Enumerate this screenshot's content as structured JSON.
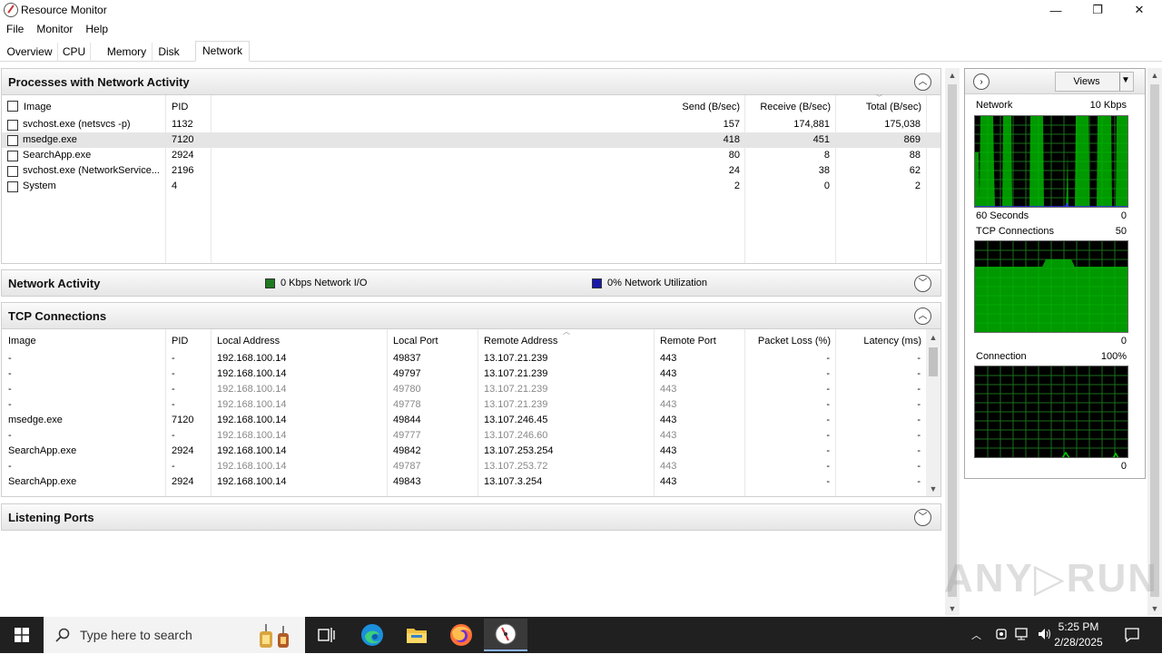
{
  "window": {
    "title": "Resource Monitor",
    "controls": {
      "minimize": "—",
      "maximize": "❐",
      "close": "✕"
    }
  },
  "menu": [
    "File",
    "Monitor",
    "Help"
  ],
  "tabs": [
    {
      "label": "Overview"
    },
    {
      "label": "CPU"
    },
    {
      "label": "Memory"
    },
    {
      "label": "Disk"
    },
    {
      "label": "Network",
      "active": true
    }
  ],
  "processes": {
    "title": "Processes with Network Activity",
    "columns": {
      "image": "Image",
      "pid": "PID",
      "send": "Send (B/sec)",
      "receive": "Receive (B/sec)",
      "total": "Total (B/sec)"
    },
    "rows": [
      {
        "image": "svchost.exe (netsvcs -p)",
        "pid": "1132",
        "send": "157",
        "receive": "174,881",
        "total": "175,038"
      },
      {
        "image": "msedge.exe",
        "pid": "7120",
        "send": "418",
        "receive": "451",
        "total": "869",
        "selected": true
      },
      {
        "image": "SearchApp.exe",
        "pid": "2924",
        "send": "80",
        "receive": "8",
        "total": "88"
      },
      {
        "image": "svchost.exe (NetworkService...",
        "pid": "2196",
        "send": "24",
        "receive": "38",
        "total": "62"
      },
      {
        "image": "System",
        "pid": "4",
        "send": "2",
        "receive": "0",
        "total": "2"
      }
    ]
  },
  "network_activity": {
    "title": "Network Activity",
    "io_label": "0 Kbps Network I/O",
    "util_label": "0% Network Utilization",
    "io_color": "#1f7a1f",
    "util_color": "#1a1aaa"
  },
  "tcp": {
    "title": "TCP Connections",
    "columns": {
      "image": "Image",
      "pid": "PID",
      "local_address": "Local Address",
      "local_port": "Local Port",
      "remote_address": "Remote Address",
      "remote_port": "Remote Port",
      "packet_loss": "Packet Loss (%)",
      "latency": "Latency (ms)"
    },
    "rows": [
      {
        "image": "-",
        "pid": "-",
        "local_address": "192.168.100.14",
        "local_port": "49837",
        "remote_address": "13.107.21.239",
        "remote_port": "443",
        "packet_loss": "-",
        "latency": "-",
        "dim": false
      },
      {
        "image": "-",
        "pid": "-",
        "local_address": "192.168.100.14",
        "local_port": "49797",
        "remote_address": "13.107.21.239",
        "remote_port": "443",
        "packet_loss": "-",
        "latency": "-",
        "dim": false
      },
      {
        "image": "-",
        "pid": "-",
        "local_address": "192.168.100.14",
        "local_port": "49780",
        "remote_address": "13.107.21.239",
        "remote_port": "443",
        "packet_loss": "-",
        "latency": "-",
        "dim": true
      },
      {
        "image": "-",
        "pid": "-",
        "local_address": "192.168.100.14",
        "local_port": "49778",
        "remote_address": "13.107.21.239",
        "remote_port": "443",
        "packet_loss": "-",
        "latency": "-",
        "dim": true
      },
      {
        "image": "msedge.exe",
        "pid": "7120",
        "local_address": "192.168.100.14",
        "local_port": "49844",
        "remote_address": "13.107.246.45",
        "remote_port": "443",
        "packet_loss": "-",
        "latency": "-",
        "dim": false
      },
      {
        "image": "-",
        "pid": "-",
        "local_address": "192.168.100.14",
        "local_port": "49777",
        "remote_address": "13.107.246.60",
        "remote_port": "443",
        "packet_loss": "-",
        "latency": "-",
        "dim": true
      },
      {
        "image": "SearchApp.exe",
        "pid": "2924",
        "local_address": "192.168.100.14",
        "local_port": "49842",
        "remote_address": "13.107.253.254",
        "remote_port": "443",
        "packet_loss": "-",
        "latency": "-",
        "dim": false
      },
      {
        "image": "-",
        "pid": "-",
        "local_address": "192.168.100.14",
        "local_port": "49787",
        "remote_address": "13.107.253.72",
        "remote_port": "443",
        "packet_loss": "-",
        "latency": "-",
        "dim": true
      },
      {
        "image": "SearchApp.exe",
        "pid": "2924",
        "local_address": "192.168.100.14",
        "local_port": "49843",
        "remote_address": "13.107.3.254",
        "remote_port": "443",
        "packet_loss": "-",
        "latency": "-",
        "dim": false
      }
    ]
  },
  "listening": {
    "title": "Listening Ports"
  },
  "graphs": {
    "views_label": "Views",
    "network": {
      "label": "Network",
      "max": "10 Kbps",
      "footer_left": "60 Seconds",
      "footer_right": "0"
    },
    "tcp": {
      "label": "TCP Connections",
      "max": "50",
      "footer_right": "0"
    },
    "connection": {
      "label": "Connection",
      "max": "100%",
      "footer_right": "0"
    }
  },
  "taskbar": {
    "search_placeholder": "Type here to search",
    "time": "5:25 PM",
    "date": "2/28/2025",
    "icons": [
      "task-view-icon",
      "edge-icon",
      "file-explorer-icon",
      "firefox-icon",
      "resource-monitor-icon"
    ]
  }
}
